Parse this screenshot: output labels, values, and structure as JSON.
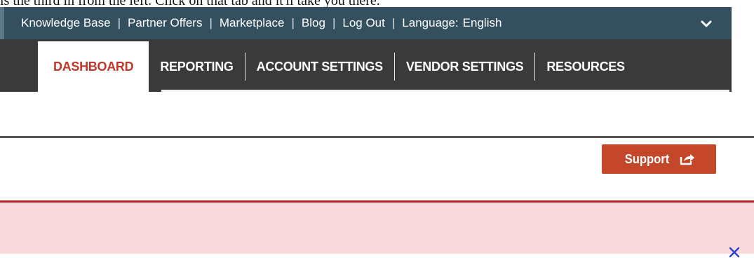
{
  "caption": "is the third in from the left. Click on that tab and it'll take you there.",
  "top_links": [
    "Knowledge Base",
    "Partner Offers",
    "Marketplace",
    "Blog",
    "Log Out"
  ],
  "language": {
    "label": "Language:",
    "value": "English"
  },
  "nav_tabs": [
    {
      "label": "DASHBOARD",
      "active": true
    },
    {
      "label": "REPORTING",
      "active": false
    },
    {
      "label": "ACCOUNT SETTINGS",
      "active": false
    },
    {
      "label": "VENDOR SETTINGS",
      "active": false
    },
    {
      "label": "RESOURCES",
      "active": false
    }
  ],
  "support": {
    "label": "Support"
  },
  "icons": {
    "language_dropdown": "chevron-down-icon",
    "support": "share-external-icon",
    "alert_close": "close-icon"
  },
  "colors": {
    "topbar": "#34505f",
    "navbar": "#3a3a3a",
    "active_tab_text": "#c0392b",
    "support_button": "#c4472a",
    "alert_background": "#fadadd",
    "alert_border": "#b22222"
  }
}
